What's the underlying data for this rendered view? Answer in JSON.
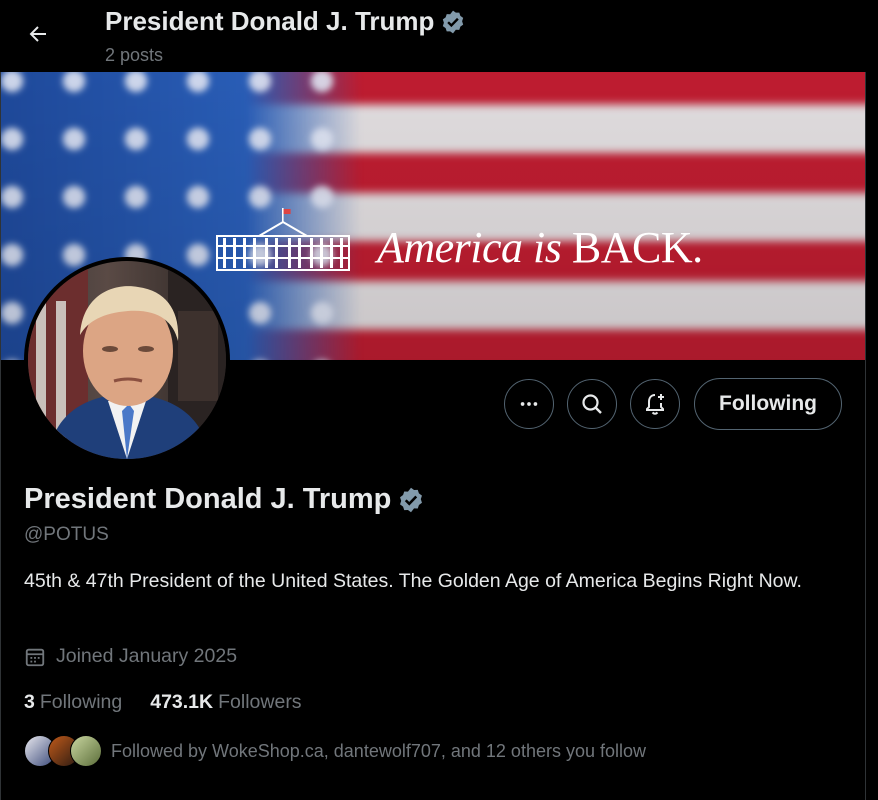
{
  "header": {
    "title": "President Donald J. Trump",
    "post_count": "2 posts"
  },
  "banner": {
    "text_italic": "America is",
    "text_upright": " BACK."
  },
  "profile": {
    "name": "President Donald J. Trump",
    "handle": "@POTUS",
    "bio": "45th & 47th President of the United States. The Golden Age of America Begins Right Now.",
    "joined": "Joined January 2025",
    "verified_color": "#829aab"
  },
  "actions": {
    "more_icon": "more-horizontal-icon",
    "search_icon": "search-icon",
    "notify_icon": "bell-plus-icon",
    "follow_label": "Following"
  },
  "stats": {
    "following_count": "3",
    "following_label": "Following",
    "followers_count": "473.1K",
    "followers_label": "Followers"
  },
  "followed_by": "Followed by WokeShop.ca, dantewolf707, and 12 others you follow",
  "colors": {
    "background": "#000000",
    "text": "#e7e9ea",
    "muted": "#71767b",
    "border": "#536471"
  }
}
